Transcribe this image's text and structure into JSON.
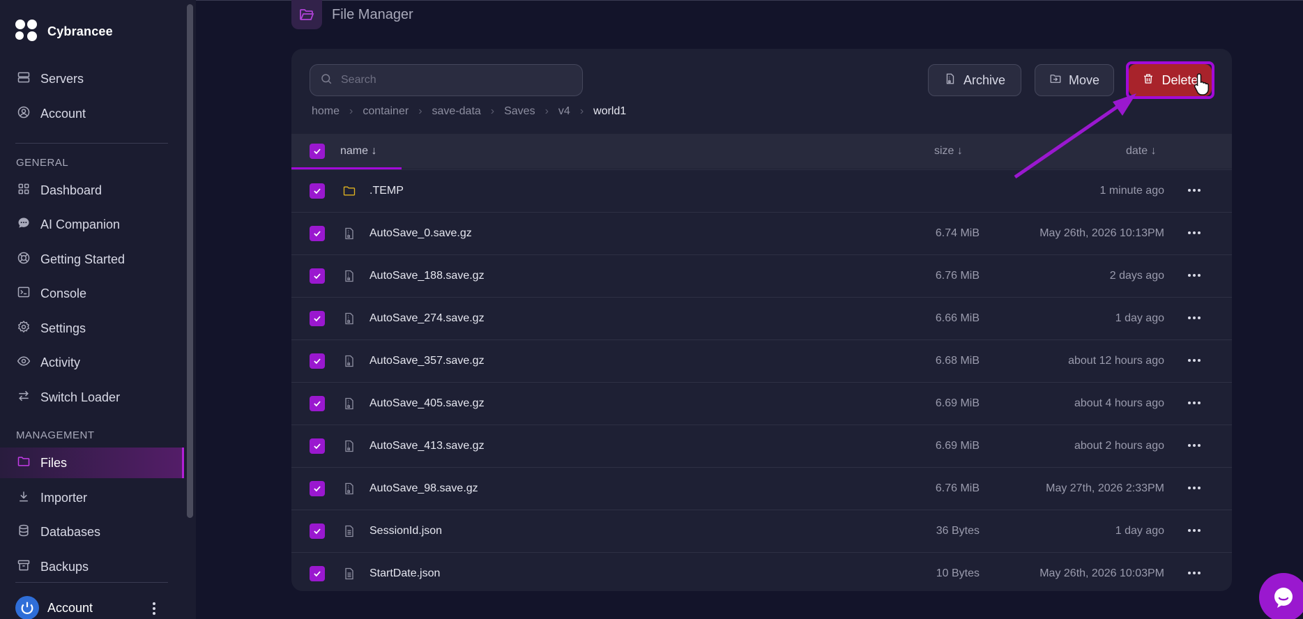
{
  "brand": {
    "name": "Cybrancee"
  },
  "sidebar": {
    "top_items": [
      {
        "label": "Servers",
        "icon": "server-icon"
      },
      {
        "label": "Account",
        "icon": "user-circle-icon"
      }
    ],
    "general_label": "GENERAL",
    "general_items": [
      {
        "label": "Dashboard",
        "icon": "grid-icon"
      },
      {
        "label": "AI Companion",
        "icon": "chat-icon"
      },
      {
        "label": "Getting Started",
        "icon": "lifebuoy-icon"
      },
      {
        "label": "Console",
        "icon": "terminal-icon"
      },
      {
        "label": "Settings",
        "icon": "gear-icon"
      },
      {
        "label": "Activity",
        "icon": "eye-icon"
      },
      {
        "label": "Switch Loader",
        "icon": "swap-icon"
      }
    ],
    "management_label": "MANAGEMENT",
    "management_items": [
      {
        "label": "Files",
        "icon": "folder-icon",
        "active": true
      },
      {
        "label": "Importer",
        "icon": "download-icon"
      },
      {
        "label": "Databases",
        "icon": "database-icon"
      },
      {
        "label": "Backups",
        "icon": "archive-icon"
      }
    ],
    "account_label": "Account"
  },
  "page": {
    "title": "File Manager"
  },
  "search": {
    "placeholder": "Search",
    "value": ""
  },
  "toolbar": {
    "archive_label": "Archive",
    "move_label": "Move",
    "delete_label": "Delete"
  },
  "breadcrumb": [
    "home",
    "container",
    "save-data",
    "Saves",
    "v4",
    "world1"
  ],
  "table": {
    "headers": {
      "name": "name ↓",
      "size": "size ↓",
      "date": "date ↓"
    },
    "rows": [
      {
        "name": ".TEMP",
        "type": "folder",
        "size": "",
        "date": "1 minute ago"
      },
      {
        "name": "AutoSave_0.save.gz",
        "type": "archive",
        "size": "6.74 MiB",
        "date": "May 26th, 2026 10:13PM"
      },
      {
        "name": "AutoSave_188.save.gz",
        "type": "archive",
        "size": "6.76 MiB",
        "date": "2 days ago"
      },
      {
        "name": "AutoSave_274.save.gz",
        "type": "archive",
        "size": "6.66 MiB",
        "date": "1 day ago"
      },
      {
        "name": "AutoSave_357.save.gz",
        "type": "archive",
        "size": "6.68 MiB",
        "date": "about 12 hours ago"
      },
      {
        "name": "AutoSave_405.save.gz",
        "type": "archive",
        "size": "6.69 MiB",
        "date": "about 4 hours ago"
      },
      {
        "name": "AutoSave_413.save.gz",
        "type": "archive",
        "size": "6.69 MiB",
        "date": "about 2 hours ago"
      },
      {
        "name": "AutoSave_98.save.gz",
        "type": "archive",
        "size": "6.76 MiB",
        "date": "May 27th, 2026 2:33PM"
      },
      {
        "name": "SessionId.json",
        "type": "file",
        "size": "36 Bytes",
        "date": "1 day ago"
      },
      {
        "name": "StartDate.json",
        "type": "file",
        "size": "10 Bytes",
        "date": "May 26th, 2026 10:03PM"
      }
    ]
  },
  "colors": {
    "accent": "#a20ad8",
    "delete": "#a8232b",
    "folder": "#e0b320",
    "background": "#13142a",
    "panel": "#1e2034"
  }
}
